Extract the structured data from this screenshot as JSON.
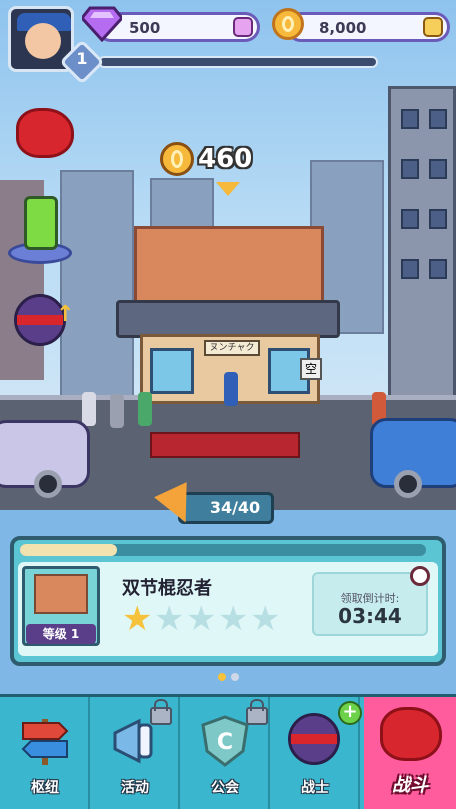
{
  "hud": {
    "level": "1",
    "gems": "500",
    "coins": "8,000",
    "gem_color": "#b56cf0",
    "coin_color": "#f6b93b"
  },
  "side_buttons": [
    {
      "icon": "red-boxing-glove-icon"
    },
    {
      "icon": "green-capsule-icon"
    },
    {
      "icon": "ninja-upgrade-icon"
    }
  ],
  "scene": {
    "reward_amount": "460",
    "sign_text": "ヌンチャク",
    "shop_sign": "空"
  },
  "energy": {
    "value": "34/40",
    "icon": "pizza-slice-icon"
  },
  "panel": {
    "progress_fraction": 0.24,
    "building_name": "双节棍忍者",
    "level_label": "等级 1",
    "stars_filled": 1,
    "stars_total": 5,
    "timer_label": "领取倒计时:",
    "timer_value": "03:44"
  },
  "pager": {
    "pages": 2,
    "active": 0
  },
  "nav": {
    "items": [
      {
        "label": "枢纽",
        "icon": "signpost-icon",
        "locked": false
      },
      {
        "label": "活动",
        "icon": "megaphone-icon",
        "locked": true
      },
      {
        "label": "公会",
        "icon": "guild-shield-icon",
        "locked": true
      },
      {
        "label": "战士",
        "icon": "ninja-head-icon",
        "locked": false,
        "badge": "+"
      },
      {
        "label": "战斗",
        "icon": "boxing-glove-icon",
        "locked": false,
        "active": true
      }
    ]
  }
}
